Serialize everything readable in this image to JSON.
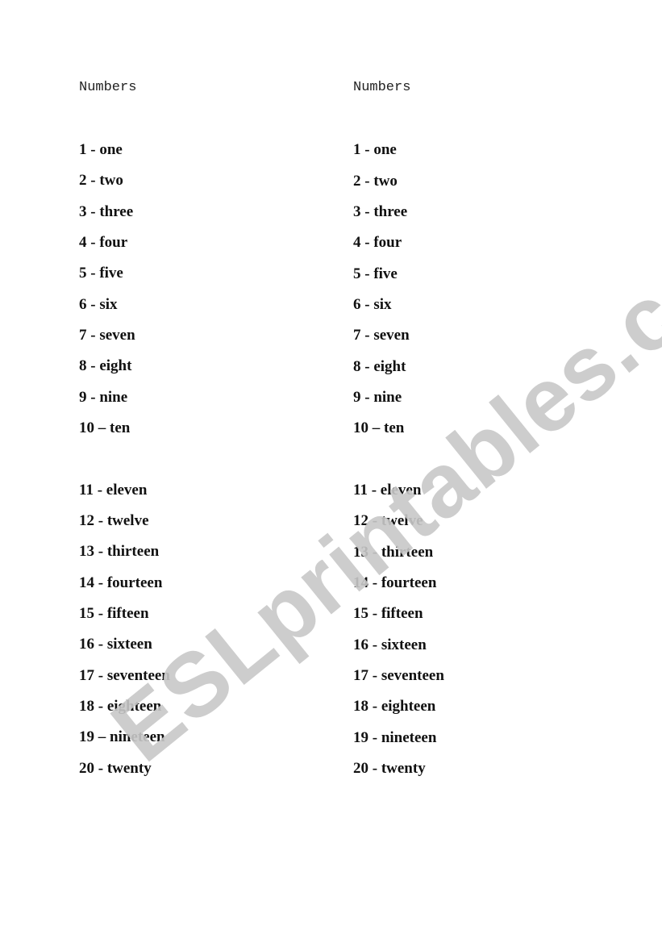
{
  "watermark": "ESLprintables.com",
  "columns": [
    {
      "title": "Numbers",
      "items": [
        "1 - one",
        "2 - two",
        "3 - three",
        "4 - four",
        "5 - five",
        "6 - six",
        "7 - seven",
        "8 - eight",
        "9 - nine",
        "10 – ten",
        "11 - eleven",
        "12 - twelve",
        "13 - thirteen",
        "14 - fourteen",
        "15 - fifteen",
        "16 - sixteen",
        "17 - seventeen",
        "18 - eighteen",
        "19 – nineteen",
        "20 - twenty"
      ]
    },
    {
      "title": "Numbers",
      "items": [
        "1 - one",
        "2 - two",
        "3 - three",
        "4 - four",
        "5 - five",
        "6 - six",
        "7 - seven",
        "8 - eight",
        "9 - nine",
        "10 – ten",
        "11 - eleven",
        "12 - twelve",
        "13 - thirteen",
        "14 - fourteen",
        "15 - fifteen",
        "16 - sixteen",
        "17 - seventeen",
        "18 - eighteen",
        "19 - nineteen",
        "20 - twenty"
      ]
    }
  ]
}
